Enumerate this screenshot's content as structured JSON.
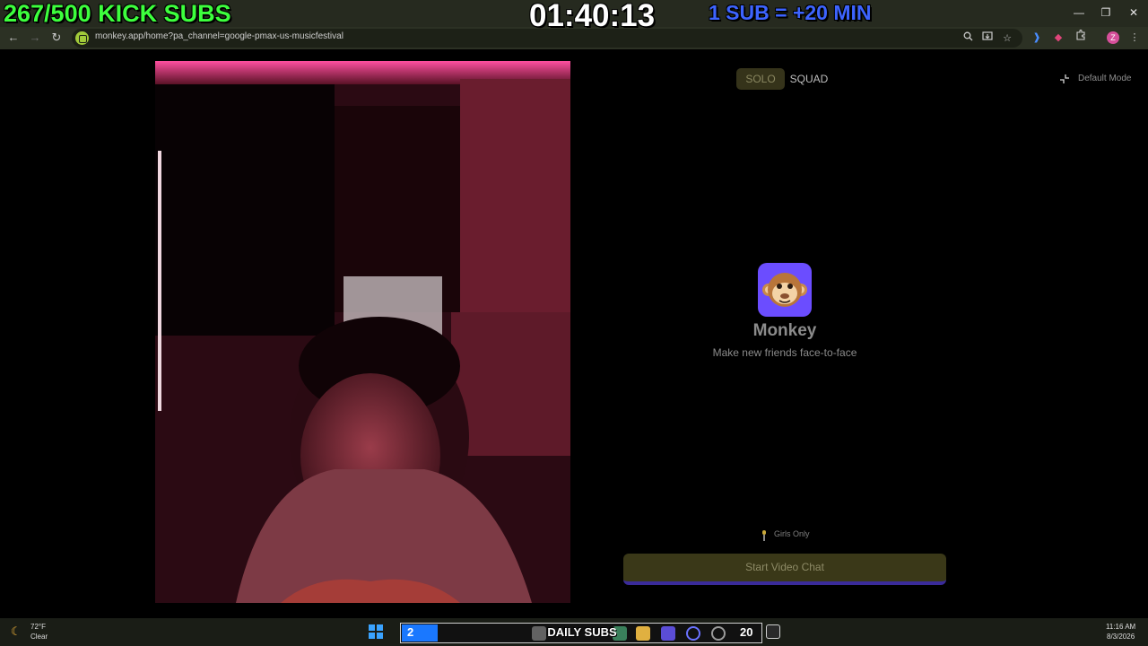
{
  "overlay": {
    "kick_subs": "267/500 KICK SUBS",
    "timer": "01:40:13",
    "sub_rule": "1 SUB = +20 MIN"
  },
  "browser": {
    "url": "monkey.app/home?pa_channel=google-pmax-us-musicfestival",
    "profile_initial": "Z",
    "icons": {
      "back": "back-arrow-icon",
      "forward": "forward-arrow-icon",
      "reload": "reload-icon",
      "zoom": "search-icon",
      "install": "install-app-icon",
      "bookmark": "star-icon",
      "extensions": "puzzle-icon",
      "menu": "kebab-menu-icon"
    }
  },
  "main": {
    "mode_tabs": [
      {
        "label": "SOLO",
        "selected": true
      },
      {
        "label": "SQUAD",
        "selected": false
      }
    ],
    "default_mode_label": "Default Mode",
    "app_name": "Monkey",
    "tagline": "Make new friends face-to-face",
    "girls_only_label": "Girls Only",
    "start_button_label": "Start Video Chat"
  },
  "taskbar": {
    "weather_temp": "72°F",
    "weather_condition": "Clear",
    "daily_subs": {
      "title": "DAILY SUBS",
      "count": "2",
      "goal": "20",
      "progress_fraction": 0.1
    },
    "time": "11:16 AM",
    "date": "8/3/2026"
  },
  "colors": {
    "overlay_green": "#3dff3d",
    "overlay_blue": "#3d64ff",
    "brand_purple": "#6b4dff",
    "button_olive": "#3a3818",
    "progress_blue": "#1a78ff"
  }
}
